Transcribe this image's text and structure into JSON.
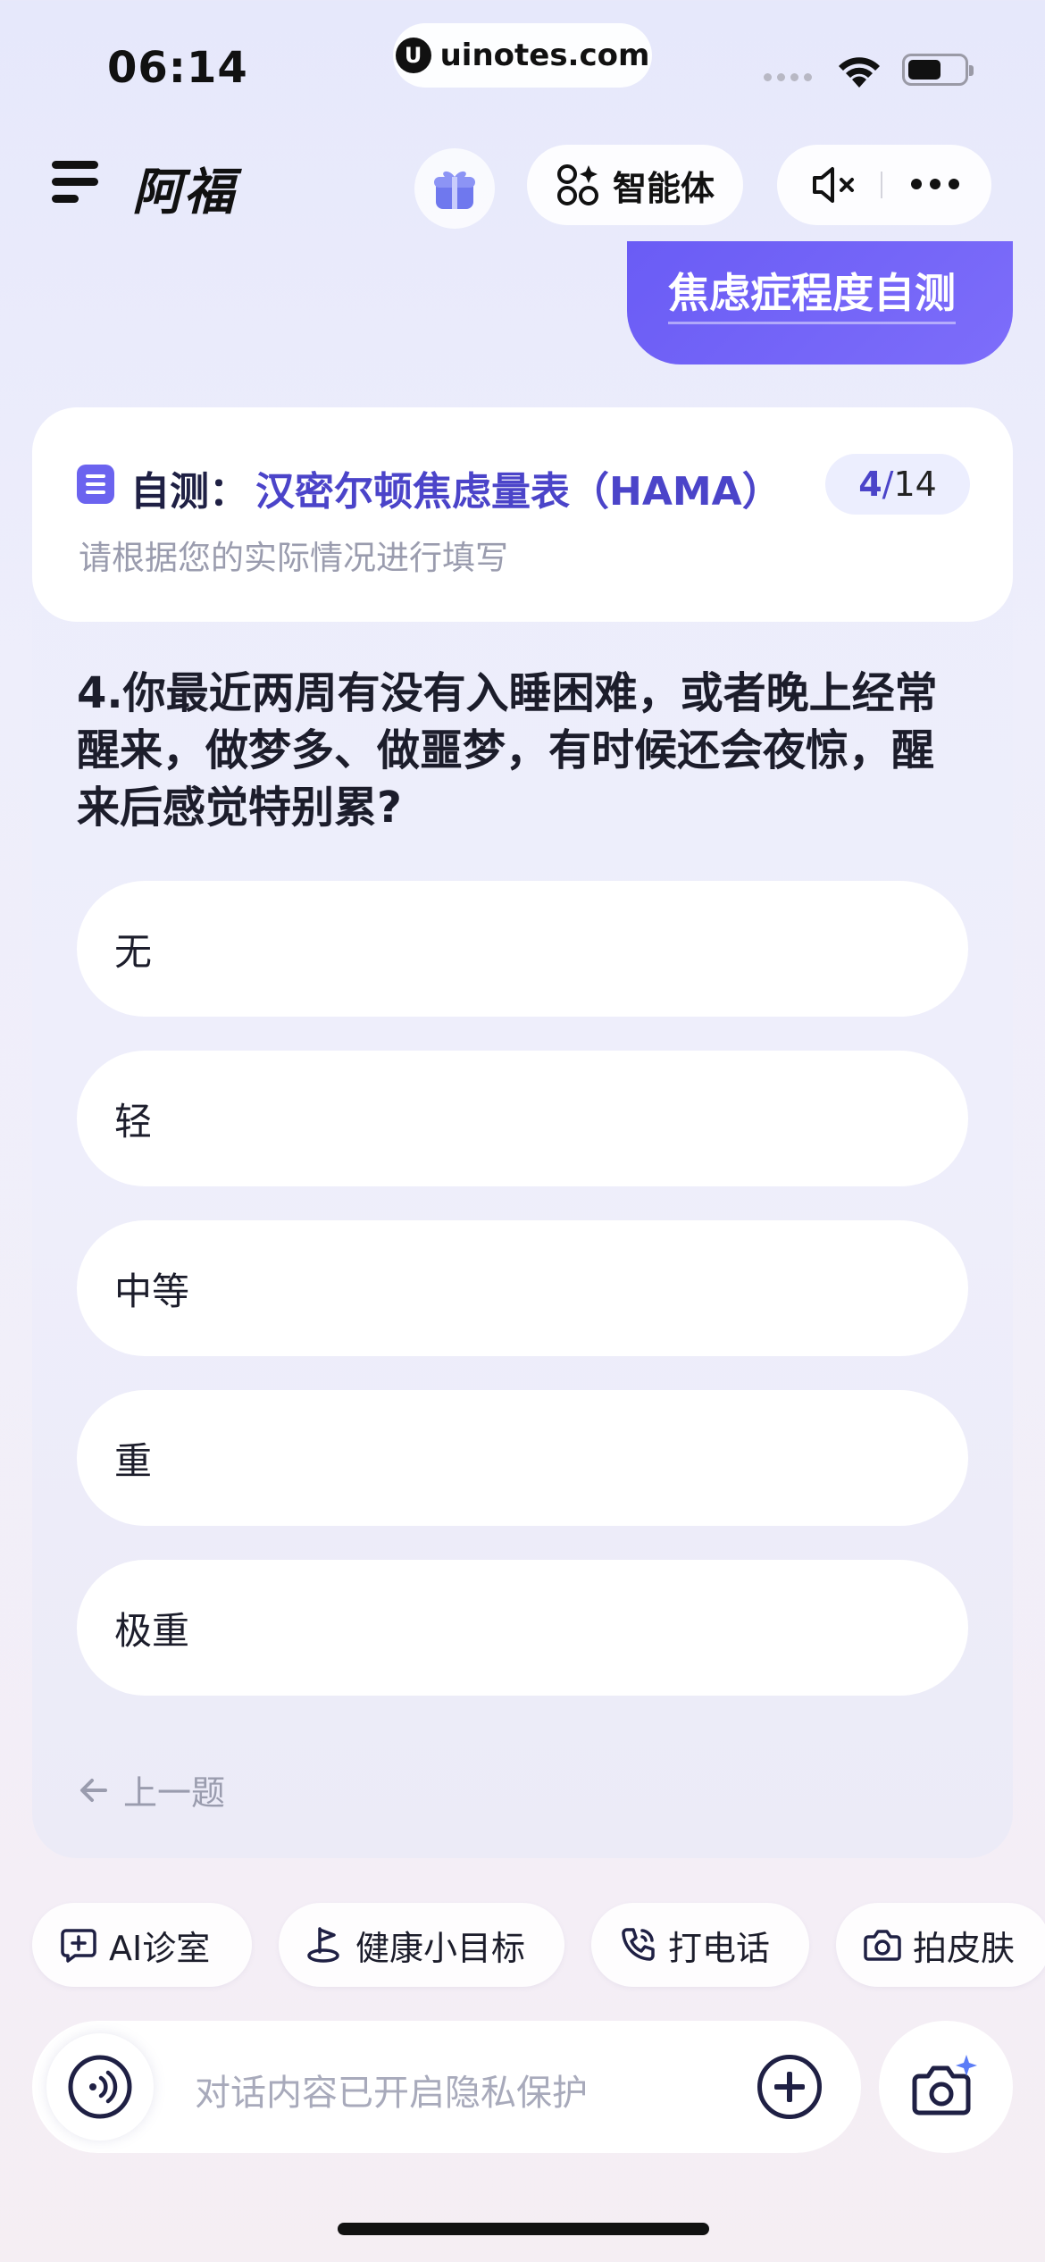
{
  "status_bar": {
    "time": "06:14",
    "url": "uinotes.com"
  },
  "header": {
    "title": "阿福",
    "agent_label": "智能体",
    "icons": [
      "menu-icon",
      "gift-icon",
      "agent-icon",
      "mute-icon",
      "more-icon"
    ]
  },
  "chat": {
    "user_message": "焦虑症程度自测"
  },
  "survey": {
    "label": "自测：",
    "scale_name": "汉密尔顿焦虑量表（HAMA）",
    "progress_current": "4",
    "progress_separator": "/",
    "progress_total": "14",
    "subtitle": "请根据您的实际情况进行填写",
    "question": "4.你最近两周有没有入睡困难，或者晚上经常醒来，做梦多、做噩梦，有时候还会夜惊，醒来后感觉特别累?",
    "options": [
      "无",
      "轻",
      "中等",
      "重",
      "极重"
    ],
    "prev_label": "上一题"
  },
  "quick_actions": [
    {
      "label": "AI诊室",
      "icon": "chat-plus-icon"
    },
    {
      "label": "健康小目标",
      "icon": "target-flag-icon"
    },
    {
      "label": "打电话",
      "icon": "phone-icon"
    },
    {
      "label": "拍皮肤",
      "icon": "camera-icon"
    }
  ],
  "input": {
    "placeholder": "对话内容已开启隐私保护"
  },
  "colors": {
    "accent": "#6b63ef",
    "accent_dark": "#4b44c9",
    "text": "#1c1d2b",
    "muted": "#9a9cae"
  }
}
